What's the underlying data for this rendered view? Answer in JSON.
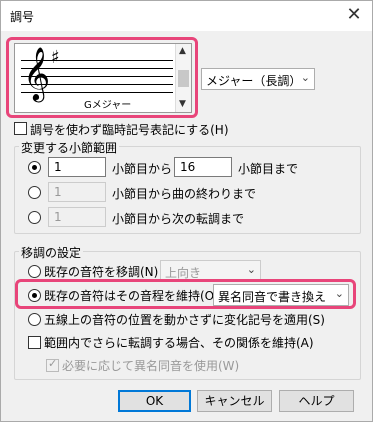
{
  "dialog": {
    "title": "調号",
    "close_glyph": "✕"
  },
  "key": {
    "clef_glyph": "𝄞",
    "sharp_glyph": "♯",
    "key_name": "Gメジャー",
    "mode_select": "メジャー（長調）",
    "scroll_up": "▲",
    "scroll_down": "▼"
  },
  "options": {
    "no_key_accidentals": "調号を使わず臨時記号表記にする(H)"
  },
  "range": {
    "group_title": "変更する小節範囲",
    "row1": {
      "from_value": "1",
      "from_label": "小節目から",
      "to_value": "16",
      "to_label": "小節目まで"
    },
    "row2": {
      "from_value": "1",
      "label": "小節目から曲の終わりまで"
    },
    "row3": {
      "from_value": "1",
      "label": "小節目から次の転調まで"
    }
  },
  "transpose": {
    "group_title": "移調の設定",
    "opt1": {
      "label": "既存の音符を移調(N)",
      "select": "上向き"
    },
    "opt2": {
      "label": "既存の音符はその音程を維持(O)",
      "select": "異名同音で書き換え"
    },
    "opt3": {
      "label": "五線上の音符の位置を動かさずに変化記号を適用(S)"
    },
    "maintain": "範囲内でさらに転調する場合、その関係を維持(A)",
    "enharmonic": "必要に応じて異名同音を使用(W)"
  },
  "buttons": {
    "ok": "OK",
    "cancel": "キャンセル",
    "help": "ヘルプ"
  },
  "colors": {
    "highlight": "#e8457a",
    "default_button": "#0078d7"
  }
}
